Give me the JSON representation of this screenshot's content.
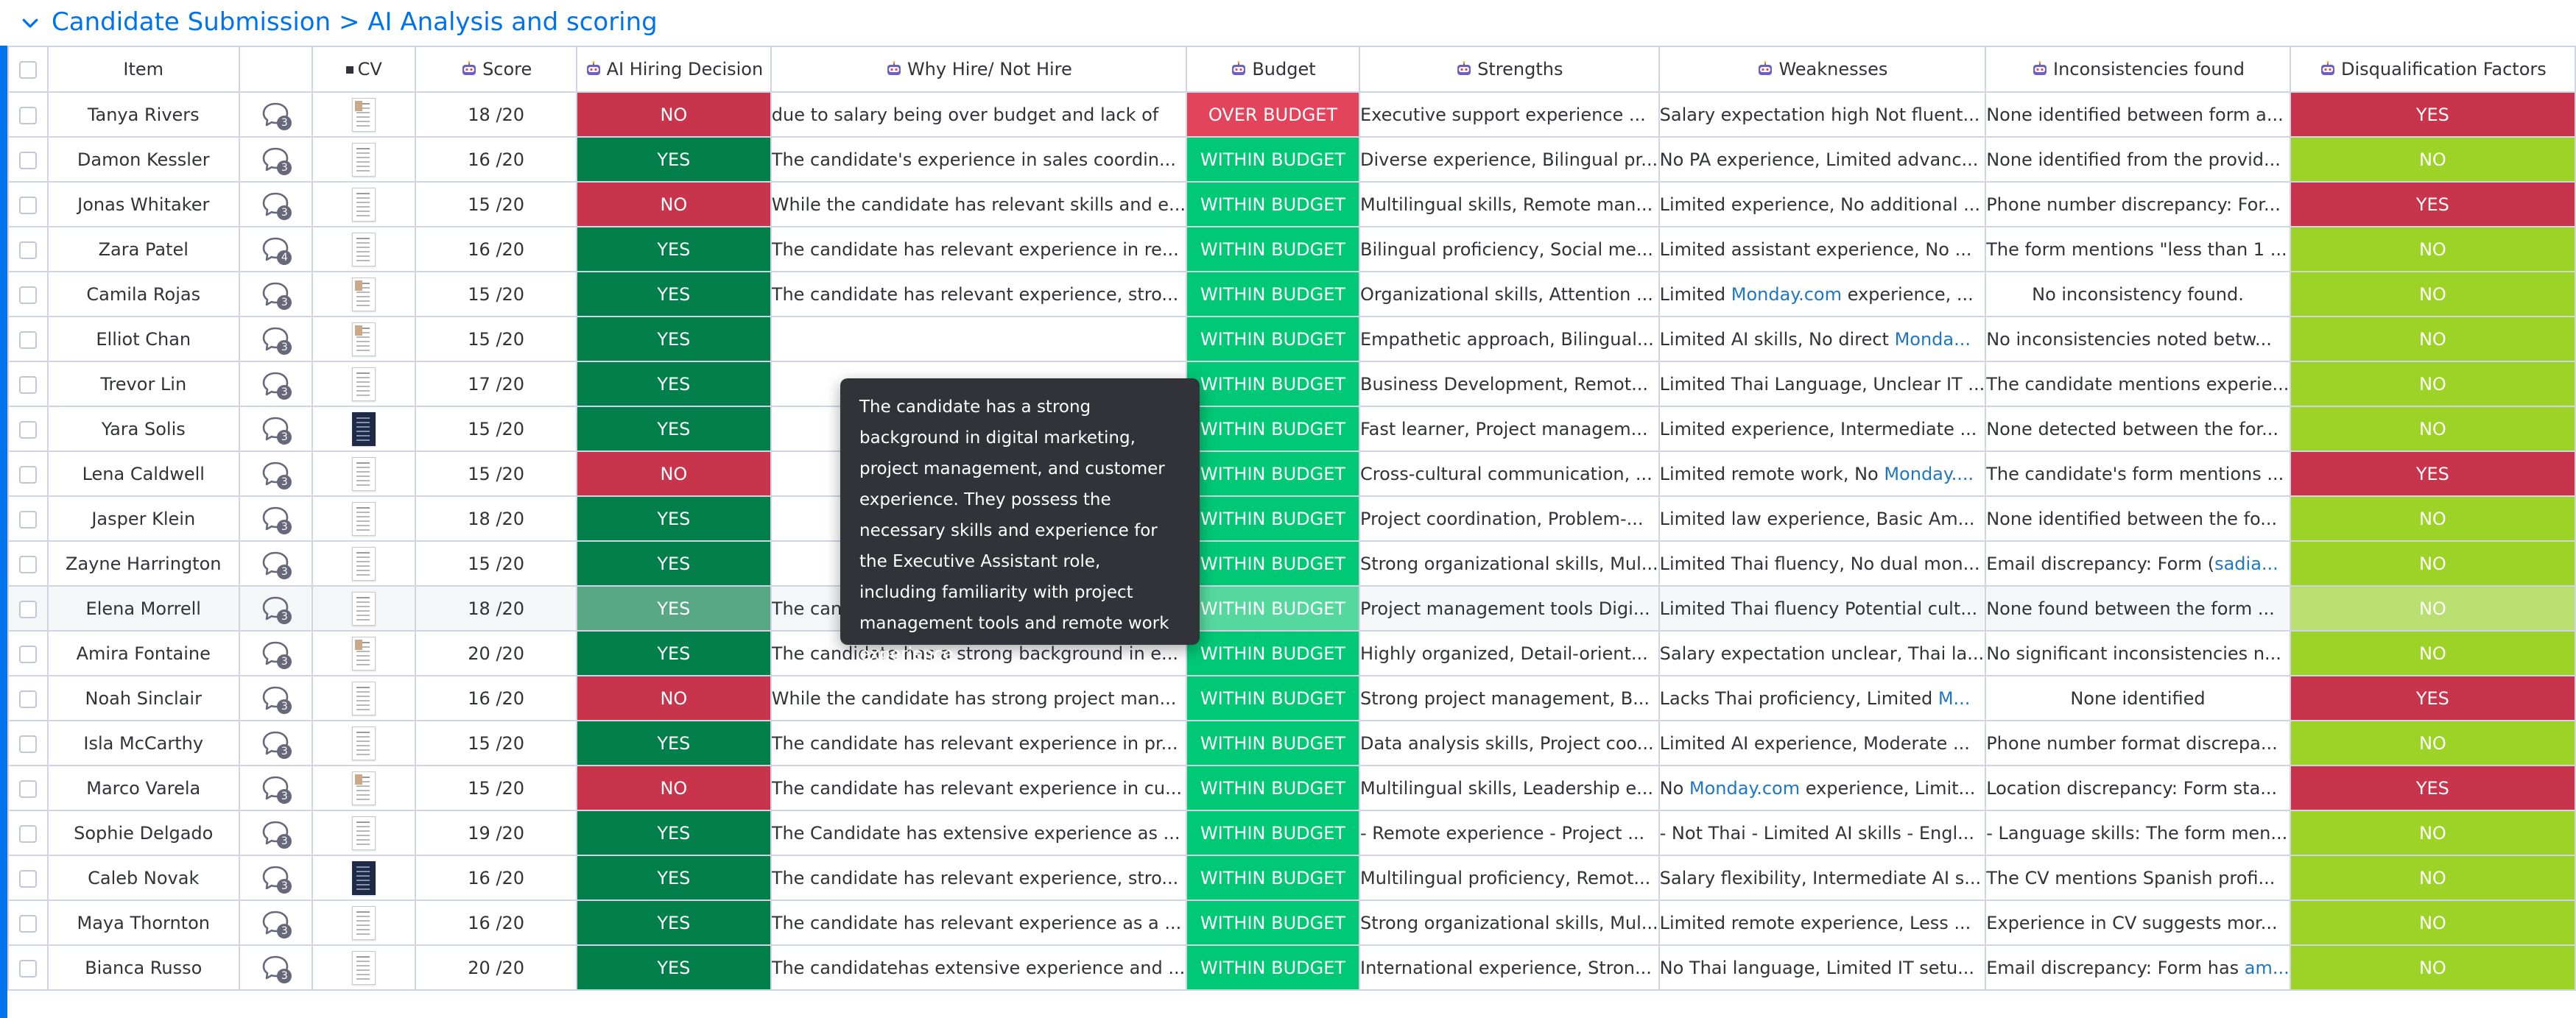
{
  "group": {
    "title": "Candidate Submission > AI Analysis and scoring"
  },
  "columns": {
    "item": "Item",
    "cv": "CV",
    "score": "Score",
    "ai_decision": "AI Hiring Decision",
    "why": "Why Hire/ Not Hire",
    "budget": "Budget",
    "strengths": "Strengths",
    "weaknesses": "Weaknesses",
    "inconsistencies": "Inconsistencies found",
    "disqualification": "Disqualification Factors"
  },
  "rows": [
    {
      "name": "Tanya Rivers",
      "updates": "3",
      "cv": "accent",
      "score": "18 /20",
      "decision": "NO",
      "why": "due to salary being over budget and lack of",
      "budget": "OVER BUDGET",
      "strengths": "Executive support experience ...",
      "weaknesses": "Salary expectation high Not fluent...",
      "inconsistencies": "None identified between form a...",
      "disq": "YES"
    },
    {
      "name": "Damon Kessler",
      "updates": "3",
      "cv": "plain",
      "score": "16 /20",
      "decision": "YES",
      "why": "The candidate's experience in sales coordin...",
      "budget": "WITHIN BUDGET",
      "strengths": "Diverse experience, Bilingual pr...",
      "weaknesses": "No PA experience, Limited advanc...",
      "inconsistencies": "None identified from the provid...",
      "disq": "NO"
    },
    {
      "name": "Jonas Whitaker",
      "updates": "3",
      "cv": "plain",
      "score": "15 /20",
      "decision": "NO",
      "why": "While the candidate has relevant skills and e...",
      "budget": "WITHIN BUDGET",
      "strengths": "Multilingual skills, Remote man...",
      "weaknesses": "Limited experience, No additional ...",
      "inconsistencies": "Phone number discrepancy: For...",
      "disq": "YES"
    },
    {
      "name": "Zara Patel",
      "updates": "4",
      "cv": "plain",
      "score": "16 /20",
      "decision": "YES",
      "why": "The candidate has relevant experience in re...",
      "budget": "WITHIN BUDGET",
      "strengths": "Bilingual proficiency, Social me...",
      "weaknesses": "Limited assistant experience, No ...",
      "inconsistencies": "The form mentions \"less than 1 ...",
      "disq": "NO"
    },
    {
      "name": "Camila Rojas",
      "updates": "3",
      "cv": "accent",
      "score": "15 /20",
      "decision": "YES",
      "why": "The candidate has relevant experience, stro...",
      "budget": "WITHIN BUDGET",
      "strengths": "Organizational skills, Attention ...",
      "weaknesses_pre": "Limited ",
      "weaknesses_link": "Monday.com",
      "weaknesses_post": " experience, ...",
      "inconsistencies": "No inconsistency found.",
      "inconsistencies_center": true,
      "disq": "NO"
    },
    {
      "name": "Elliot Chan",
      "updates": "3",
      "cv": "accent",
      "score": "15 /20",
      "decision": "YES",
      "why": "",
      "budget": "WITHIN BUDGET",
      "strengths": "Empathetic approach, Bilingual...",
      "weaknesses_pre": "Limited AI skills, No direct ",
      "weaknesses_link": "Monda...",
      "weaknesses_post": "",
      "inconsistencies": "No inconsistencies noted betw...",
      "disq": "NO"
    },
    {
      "name": "Trevor Lin",
      "updates": "3",
      "cv": "plain",
      "score": "17 /20",
      "decision": "YES",
      "why": "",
      "budget": "WITHIN BUDGET",
      "strengths": "Business Development, Remot...",
      "weaknesses": "Limited Thai Language, Unclear IT ...",
      "inconsistencies": "The candidate mentions experie...",
      "disq": "NO"
    },
    {
      "name": "Yara Solis",
      "updates": "3",
      "cv": "dark",
      "score": "15 /20",
      "decision": "YES",
      "why": "",
      "budget": "WITHIN BUDGET",
      "strengths": "Fast learner, Project managem...",
      "weaknesses": "Limited experience, Intermediate ...",
      "inconsistencies": "None detected between the for...",
      "disq": "NO"
    },
    {
      "name": "Lena Caldwell",
      "updates": "3",
      "cv": "plain",
      "score": "15 /20",
      "decision": "NO",
      "why": "",
      "budget": "WITHIN BUDGET",
      "strengths": "Cross-cultural communication, ...",
      "weaknesses_pre": "Limited remote work, No ",
      "weaknesses_link": "Monday....",
      "weaknesses_post": "",
      "inconsistencies": "The candidate's form mentions ...",
      "disq": "YES"
    },
    {
      "name": "Jasper Klein",
      "updates": "3",
      "cv": "plain",
      "score": "18 /20",
      "decision": "YES",
      "why": "",
      "budget": "WITHIN BUDGET",
      "strengths": "Project coordination, Problem-...",
      "weaknesses": "Limited law experience, Basic Am...",
      "inconsistencies": "None identified between the fo...",
      "disq": "NO"
    },
    {
      "name": "Zayne Harrington",
      "updates": "3",
      "cv": "plain",
      "score": "15 /20",
      "decision": "YES",
      "why": "",
      "budget": "WITHIN BUDGET",
      "strengths": "Strong organizational skills, Mul...",
      "weaknesses": "Limited Thai fluency, No dual mon...",
      "inconsistencies_pre": "Email discrepancy: Form (",
      "inconsistencies_link": "sadia...",
      "inconsistencies_post": "",
      "disq": "NO"
    },
    {
      "name": "Elena Morrell",
      "updates": "3",
      "cv": "plain",
      "score": "18 /20",
      "decision": "YES",
      "why": "The candidate has a strong background in di...",
      "budget": "WITHIN BUDGET",
      "strengths": "Project management tools Digi...",
      "weaknesses": "Limited Thai fluency Potential cult...",
      "inconsistencies": "None found between the form ...",
      "disq": "NO",
      "hovered": true
    },
    {
      "name": "Amira Fontaine",
      "updates": "3",
      "cv": "accent",
      "score": "20 /20",
      "decision": "YES",
      "why": "The candidate has a strong background in e...",
      "budget": "WITHIN BUDGET",
      "strengths": "Highly organized, Detail-orient...",
      "weaknesses": "Salary expectation unclear, Thai la...",
      "inconsistencies": "No significant inconsistencies n...",
      "disq": "NO"
    },
    {
      "name": "Noah Sinclair",
      "updates": "3",
      "cv": "plain",
      "score": "16 /20",
      "decision": "NO",
      "why": "While the candidate has strong project man...",
      "budget": "WITHIN BUDGET",
      "strengths": "Strong project management, B...",
      "weaknesses_pre": "Lacks Thai proficiency, Limited ",
      "weaknesses_link": "M...",
      "weaknesses_post": "",
      "inconsistencies": "None identified",
      "inconsistencies_center": true,
      "disq": "YES"
    },
    {
      "name": "Isla McCarthy",
      "updates": "3",
      "cv": "plain",
      "score": "15 /20",
      "decision": "YES",
      "why": "The candidate has relevant experience in pr...",
      "budget": "WITHIN BUDGET",
      "strengths": "Data analysis skills, Project coo...",
      "weaknesses": "Limited AI experience, Moderate ...",
      "inconsistencies": "Phone number format discrepa...",
      "disq": "NO"
    },
    {
      "name": "Marco Varela",
      "updates": "3",
      "cv": "accent",
      "score": "15 /20",
      "decision": "NO",
      "why": "The candidate has relevant experience in cu...",
      "budget": "WITHIN BUDGET",
      "strengths": "Multilingual skills, Leadership e...",
      "weaknesses_pre": "No ",
      "weaknesses_link": "Monday.com",
      "weaknesses_post": " experience, Limit...",
      "inconsistencies": "Location discrepancy: Form sta...",
      "disq": "YES"
    },
    {
      "name": "Sophie Delgado",
      "updates": "3",
      "cv": "plain",
      "score": "19 /20",
      "decision": "YES",
      "why": "The Candidate has extensive experience as ...",
      "budget": "WITHIN BUDGET",
      "strengths": "- Remote experience - Project ...",
      "weaknesses": "- Not Thai - Limited AI skills - Engl...",
      "inconsistencies": "- Language skills: The form men...",
      "disq": "NO"
    },
    {
      "name": "Caleb Novak",
      "updates": "3",
      "cv": "dark",
      "score": "16 /20",
      "decision": "YES",
      "why": "The candidate has relevant experience, stro...",
      "budget": "WITHIN BUDGET",
      "strengths": "Multilingual proficiency, Remot...",
      "weaknesses": "Salary flexibility, Intermediate AI s...",
      "inconsistencies": "The CV mentions Spanish profi...",
      "disq": "NO"
    },
    {
      "name": "Maya Thornton",
      "updates": "3",
      "cv": "plain",
      "score": "16 /20",
      "decision": "YES",
      "why": "The candidate has relevant experience as a ...",
      "budget": "WITHIN BUDGET",
      "strengths": "Strong organizational skills, Mul...",
      "weaknesses": "Limited remote experience, Less ...",
      "inconsistencies": "Experience in CV suggests mor...",
      "disq": "NO"
    },
    {
      "name": "Bianca Russo",
      "updates": "3",
      "cv": "plain",
      "score": "20 /20",
      "decision": "YES",
      "why": "The candidatehas extensive experience and ...",
      "budget": "WITHIN BUDGET",
      "strengths": "International experience, Stron...",
      "weaknesses": "No Thai language, Limited IT setu...",
      "inconsistencies_pre": "Email discrepancy: Form has ",
      "inconsistencies_link": "am...",
      "inconsistencies_post": "",
      "disq": "NO"
    }
  ],
  "tooltip": {
    "text": "The candidate has a strong background in digital marketing, project management, and customer experience. They possess the necessary skills and experience for the Executive Assistant role, including familiarity with project management tools and remote work experience."
  },
  "colors": {
    "accent": "#0073ea",
    "yes": "#037f4c",
    "no": "#c9344d",
    "within_budget": "#00c875",
    "over_budget": "#e2445c",
    "disq_no": "#9cd326",
    "disq_yes": "#c9344d",
    "link": "#1f76c2"
  },
  "icons": {
    "group_toggle": "chevron-down-icon",
    "column_header": "robot-icon",
    "updates": "chat-bubble-icon",
    "cv": "document-thumbnail-icon"
  }
}
